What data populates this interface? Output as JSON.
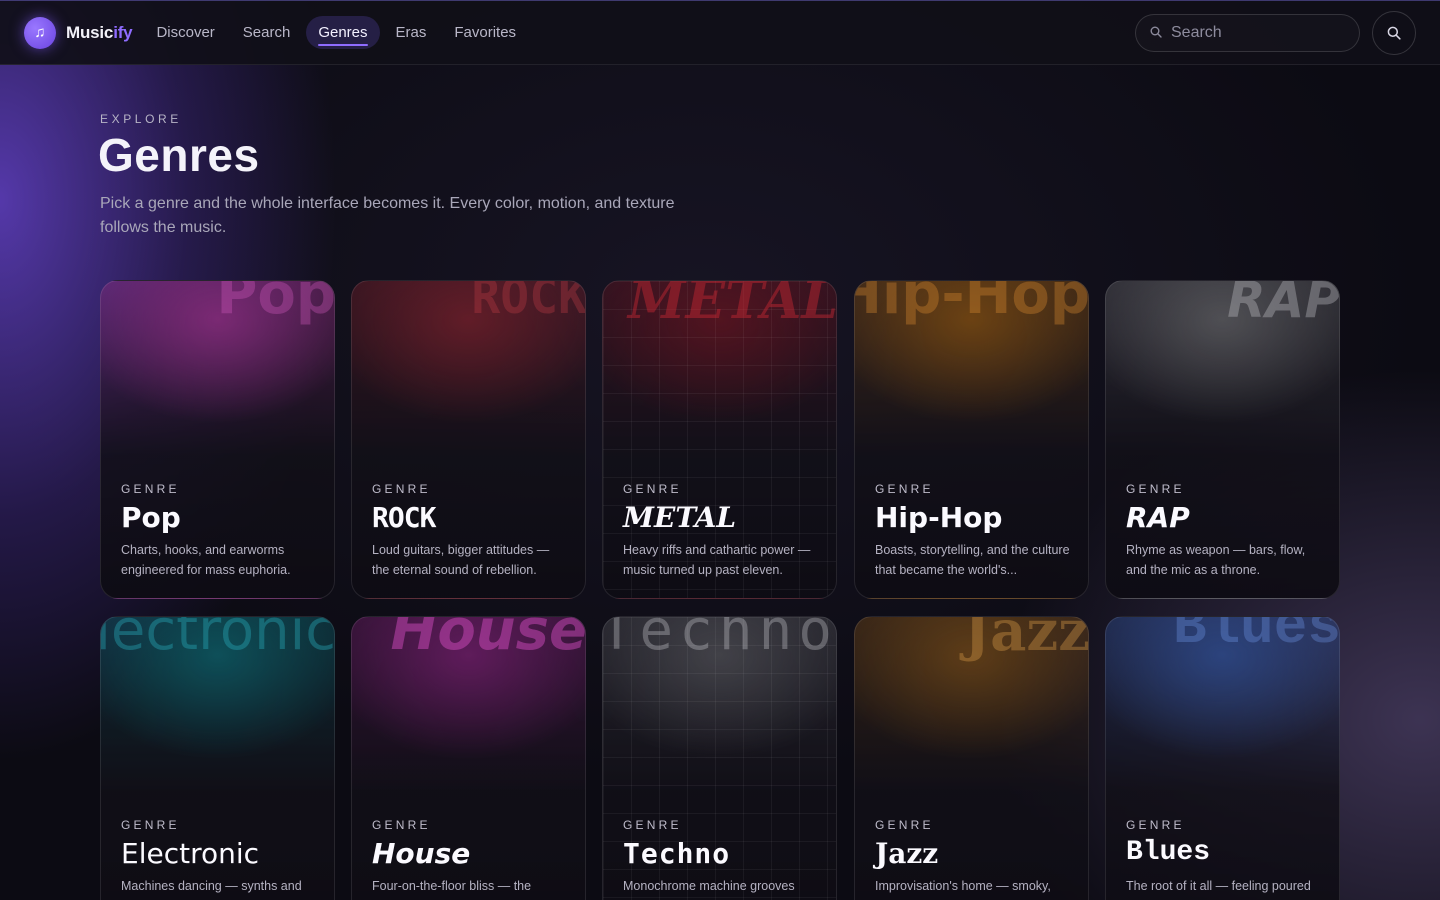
{
  "app": {
    "name_bold": "Music",
    "name_accent": "ify"
  },
  "nav": {
    "links": [
      {
        "label": "Discover"
      },
      {
        "label": "Search"
      },
      {
        "label": "Genres"
      },
      {
        "label": "Eras"
      },
      {
        "label": "Favorites"
      }
    ],
    "active": "Genres",
    "search_placeholder": "Search"
  },
  "hero": {
    "eyebrow": "EXPLORE",
    "title": "Genres",
    "subtitle": "Pick a genre and the whole interface becomes it. Every color, motion, and texture follows the music."
  },
  "cards": [
    {
      "label": "GENRE",
      "name": "Pop",
      "bg": "Pop",
      "desc": "Charts, hooks, and earworms engineered for mass euphoria.",
      "accent": "#8a2d7e"
    },
    {
      "label": "GENRE",
      "name": "ROCK",
      "bg": "ROCK",
      "desc": "Loud guitars, bigger attitudes — the eternal sound of rebellion.",
      "accent": "#6e1f2a"
    },
    {
      "label": "GENRE",
      "name": "METAL",
      "bg": "METAL",
      "desc": "Heavy riffs and cathartic power — music turned up past eleven.",
      "accent": "#5c1420"
    },
    {
      "label": "GENRE",
      "name": "Hip-Hop",
      "bg": "Hip-Hop",
      "desc": "Boasts, storytelling, and the culture that became the world's...",
      "accent": "#7a4a12"
    },
    {
      "label": "GENRE",
      "name": "RAP",
      "bg": "RAP",
      "desc": "Rhyme as weapon — bars, flow, and the mic as a throne.",
      "accent": "#5a5a5e"
    },
    {
      "label": "GENRE",
      "name": "Electronic",
      "bg": "Electronic",
      "desc": "Machines dancing — synths and",
      "accent": "#0e5a64"
    },
    {
      "label": "GENRE",
      "name": "House",
      "bg": "House",
      "desc": "Four-on-the-floor bliss — the",
      "accent": "#6c1e66"
    },
    {
      "label": "GENRE",
      "name": "Techno",
      "bg": "Techno",
      "desc": "Monochrome machine grooves",
      "accent": "#4a4a50"
    },
    {
      "label": "GENRE",
      "name": "Jazz",
      "bg": "Jazz",
      "desc": "Improvisation's home — smoky,",
      "accent": "#6a4418"
    },
    {
      "label": "GENRE",
      "name": "Blues",
      "bg": "Blues",
      "desc": "The root of it all — feeling poured",
      "accent": "#2e4a8a"
    }
  ]
}
